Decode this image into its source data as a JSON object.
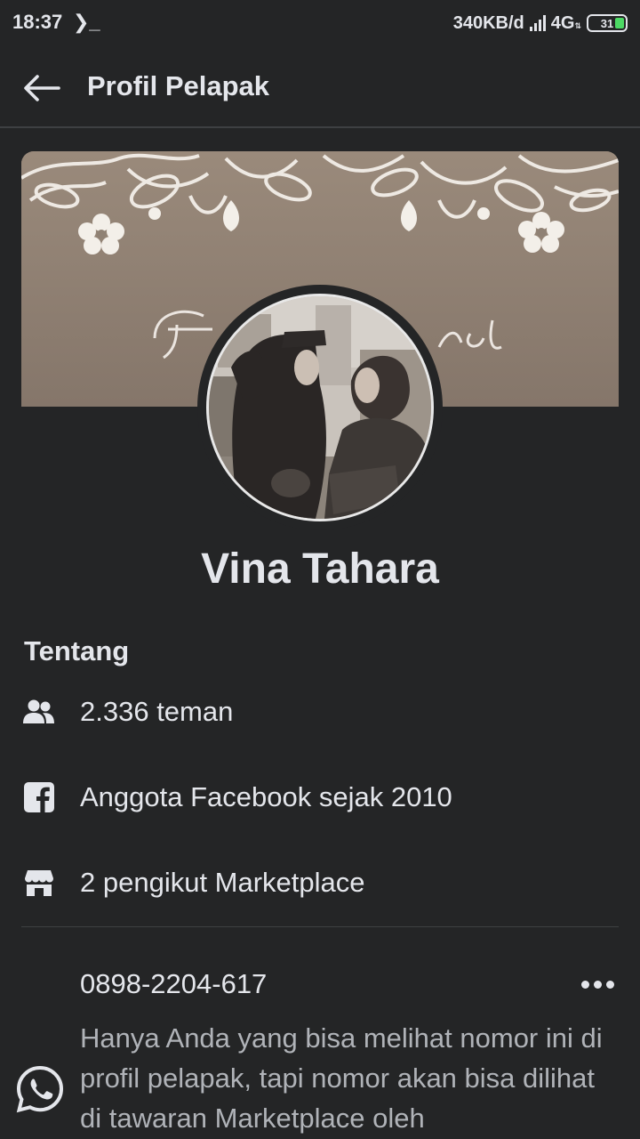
{
  "status_bar": {
    "time": "18:37",
    "terminal_glyph": "❯_",
    "net_speed": "340KB/d",
    "network": "4G",
    "battery": "31"
  },
  "header": {
    "title": "Profil Pelapak"
  },
  "profile": {
    "name": "Vina Tahara"
  },
  "about": {
    "title": "Tentang",
    "items": [
      {
        "icon": "friends-icon",
        "text": "2.336 teman"
      },
      {
        "icon": "facebook-icon",
        "text": "Anggota Facebook sejak 2010"
      },
      {
        "icon": "marketplace-store-icon",
        "text": "2 pengikut Marketplace"
      }
    ]
  },
  "contact": {
    "phone": "0898-2204-617",
    "note": "Hanya Anda yang bisa melihat nomor ini di profil pelapak, tapi nomor akan bisa dilihat di tawaran Marketplace oleh",
    "icon": "whatsapp-icon"
  },
  "colors": {
    "background": "#242526",
    "text_primary": "#e4e6eb",
    "text_secondary": "#b0b3b8",
    "divider": "#3e4042",
    "battery_green": "#4cd964"
  }
}
